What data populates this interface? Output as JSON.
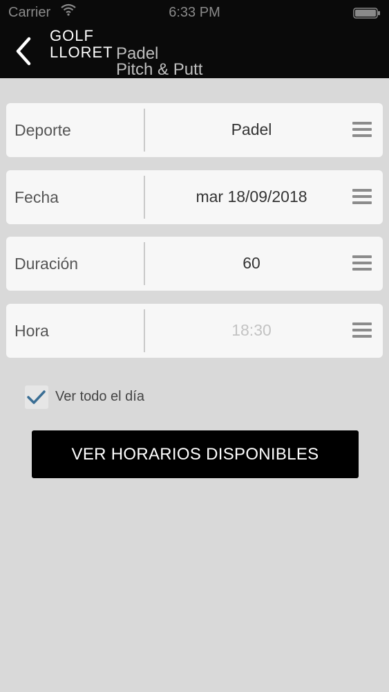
{
  "status_bar": {
    "carrier": "Carrier",
    "time": "6:33 PM",
    "wifi_icon": "wifi-icon",
    "battery_icon": "battery-icon"
  },
  "header": {
    "back_icon": "chevron-left-icon",
    "brand_line1": "GOLF",
    "brand_line2": "LLORET",
    "sub_line1": "Padel",
    "sub_line2": "Pitch & Putt"
  },
  "form": {
    "rows": [
      {
        "label": "Deporte",
        "value": "Padel",
        "placeholder": false
      },
      {
        "label": "Fecha",
        "value": "mar 18/09/2018",
        "placeholder": false
      },
      {
        "label": "Duración",
        "value": "60",
        "placeholder": false
      },
      {
        "label": "Hora",
        "value": "18:30",
        "placeholder": true
      }
    ],
    "menu_icon": "hamburger-menu-icon"
  },
  "options": {
    "all_day_checked": true,
    "all_day_label": "Ver todo el día"
  },
  "actions": {
    "submit_label": "VER HORARIOS DISPONIBLES"
  },
  "colors": {
    "background": "#d9d9d9",
    "header": "#0a0a0a",
    "row_bg": "#f7f7f7",
    "check_accent": "#3a6e94",
    "button": "#000000"
  }
}
